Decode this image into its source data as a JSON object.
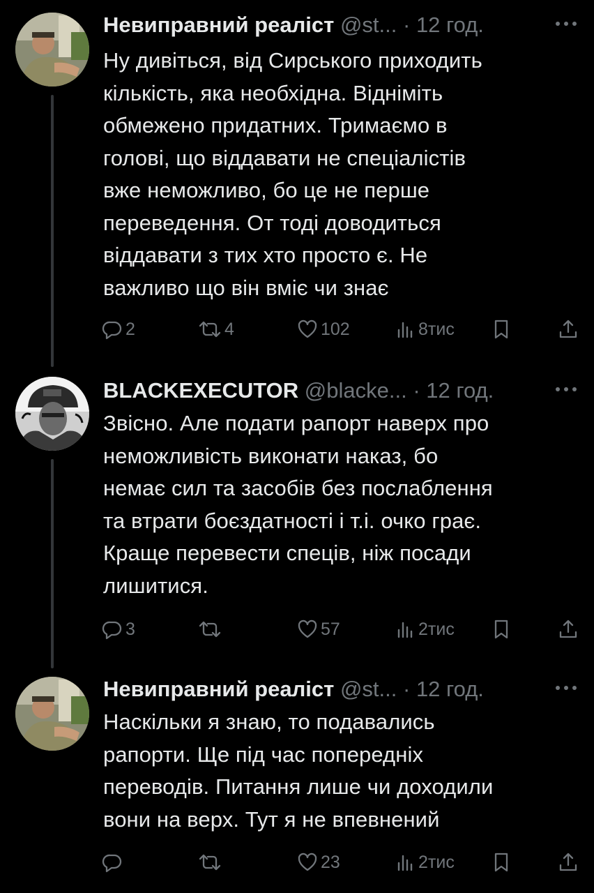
{
  "tweets": [
    {
      "name": "Невиправний реаліст",
      "handle": "@st...",
      "dot": "·",
      "time": "12 год.",
      "text": "Ну дивіться, від Сирського приходить\nкількість, яка необхідна. Відніміть\nобмежено придатних. Тримаємо в\nголові, що віддавати не спеціалістів\nвже неможливо, бо це не перше\nпереведення. От тоді доводиться\nвіддавати з тих хто просто є. Не\nважливо що він вміє чи знає",
      "replies": "2",
      "reposts": "4",
      "likes": "102",
      "views": "8тис"
    },
    {
      "name": "BLACKEXECUTOR",
      "handle": "@blacke...",
      "dot": "·",
      "time": "12 год.",
      "text": "Звісно. Але подати рапорт наверх про\nнеможливість виконати наказ, бо\nнемає сил та засобів без послаблення\nта втрати боєздатності і т.і. очко грає.\nКраще перевести спеців, ніж посади\nлишитися.",
      "replies": "3",
      "reposts": "",
      "likes": "57",
      "views": "2тис"
    },
    {
      "name": "Невиправний реаліст",
      "handle": "@st...",
      "dot": "·",
      "time": "12 год.",
      "text": "Наскільки я знаю, то подавались\nрапорти. Ще під час попередніх\nпереводів. Питання лише чи доходили\nвони на верх. Тут я не впевнений",
      "replies": "",
      "reposts": "",
      "likes": "23",
      "views": "2тис"
    }
  ],
  "icons": {
    "reply": "reply-icon",
    "repost": "repost-icon",
    "like": "heart-icon",
    "views": "views-icon",
    "bookmark": "bookmark-icon",
    "share": "share-icon",
    "more": "more-icon"
  },
  "colors": {
    "background": "#000000",
    "text": "#e7e9ea",
    "muted": "#71767b",
    "thread_line": "#333639"
  }
}
